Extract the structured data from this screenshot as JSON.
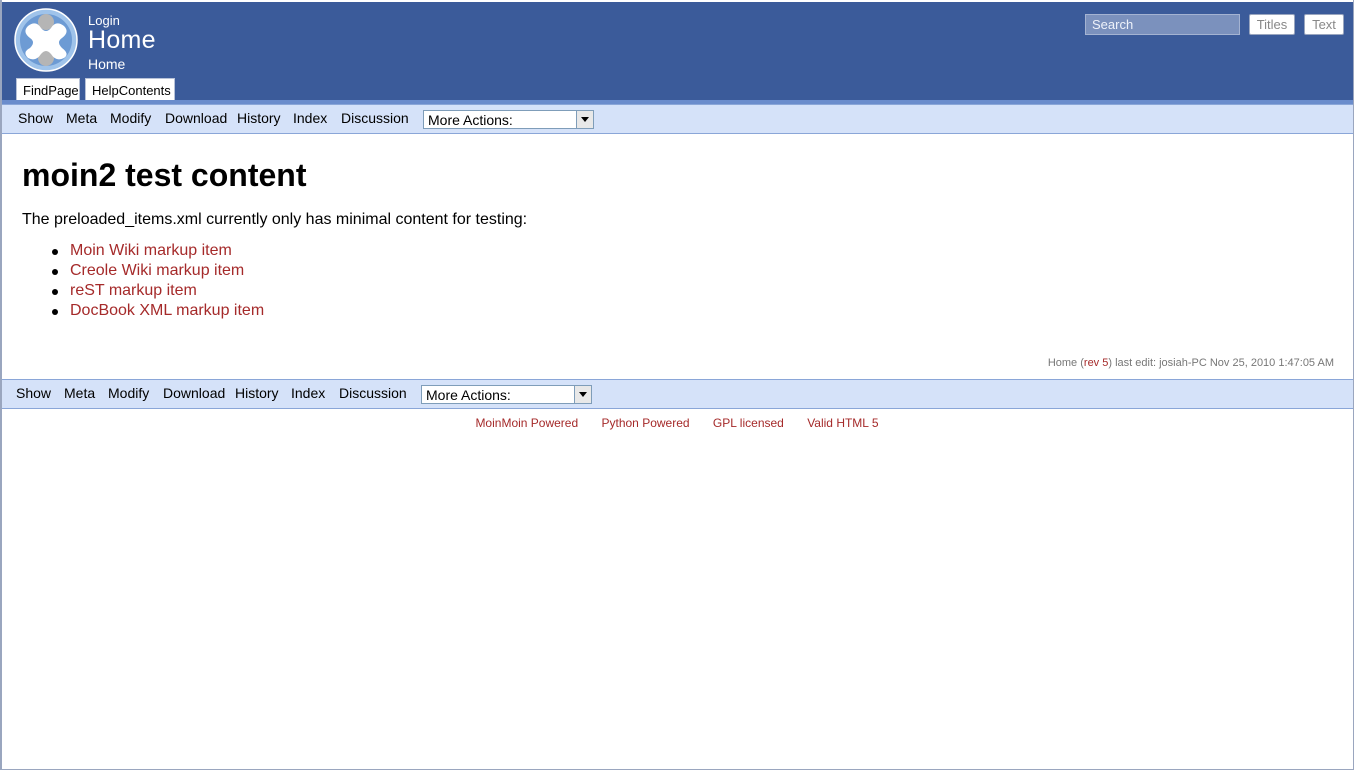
{
  "header": {
    "login": "Login",
    "site_title": "Home",
    "breadcrumb": "Home",
    "nav_tabs": [
      "FindPage",
      "HelpContents"
    ],
    "search_placeholder": "Search",
    "titles_button": "Titles",
    "text_button": "Text",
    "logo_icon": "moinmoin-logo-icon"
  },
  "actions": {
    "items": [
      "Show",
      "Meta",
      "Modify",
      "Download",
      "History",
      "Index",
      "Discussion"
    ],
    "more_actions": "More Actions:"
  },
  "content": {
    "heading": "moin2 test content",
    "intro": "The preloaded_items.xml currently only has minimal content for testing:",
    "links": [
      "Moin Wiki markup item",
      "Creole Wiki markup item",
      "reST markup item",
      "DocBook XML markup item"
    ]
  },
  "page_info": {
    "page": "Home",
    "rev_link": "rev 5",
    "open_paren": " (",
    "close_rest": ") last edit: josiah-PC Nov 25, 2010 1:47:05 AM"
  },
  "footer": {
    "links": [
      "MoinMoin Powered",
      "Python Powered",
      "GPL licensed",
      "Valid HTML 5"
    ]
  },
  "colors": {
    "header_bg": "#3b5b9a",
    "action_bar_bg": "#d5e2f9",
    "link": "#a52a2a"
  }
}
